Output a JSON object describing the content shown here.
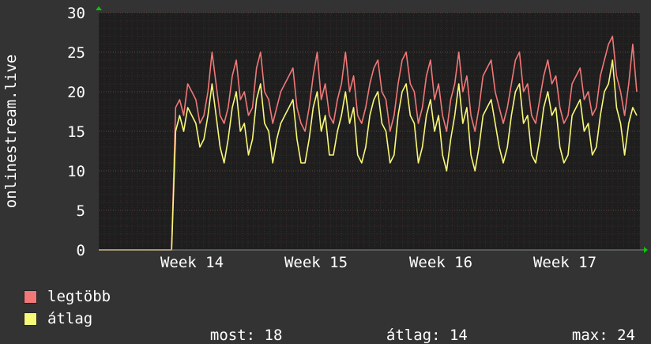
{
  "chart_data": {
    "type": "line",
    "ylabel": "onlinestream.live",
    "ylim": [
      0,
      30
    ],
    "yticks": [
      0,
      5,
      10,
      15,
      20,
      25,
      30
    ],
    "xticks": [
      "Week 14",
      "Week 15",
      "Week 16",
      "Week 17"
    ],
    "grid": true,
    "colors": {
      "background": "#333333",
      "plot": "#1e1e1e",
      "grid": "#5a3a3a",
      "text": "#ffffff",
      "arrow": "#00cc00"
    },
    "series": [
      {
        "name": "legtöbb",
        "color": "#f07878",
        "values": [
          0,
          0,
          0,
          0,
          0,
          0,
          0,
          0,
          0,
          0,
          0,
          0,
          0,
          0,
          0,
          0,
          0,
          0,
          0,
          18,
          19,
          17,
          21,
          20,
          19,
          16,
          17,
          20,
          25,
          21,
          17,
          16,
          18,
          22,
          24,
          19,
          20,
          17,
          18,
          23,
          25,
          20,
          19,
          16,
          18,
          20,
          21,
          22,
          23,
          18,
          16,
          15,
          18,
          22,
          25,
          19,
          21,
          17,
          16,
          19,
          21,
          25,
          20,
          22,
          17,
          16,
          18,
          21,
          23,
          24,
          20,
          19,
          15,
          17,
          21,
          24,
          25,
          21,
          20,
          16,
          18,
          22,
          24,
          19,
          21,
          17,
          15,
          19,
          21,
          25,
          20,
          22,
          17,
          15,
          18,
          22,
          23,
          24,
          20,
          18,
          16,
          18,
          21,
          24,
          25,
          20,
          21,
          17,
          16,
          19,
          22,
          24,
          21,
          22,
          18,
          16,
          17,
          21,
          22,
          23,
          19,
          20,
          17,
          18,
          22,
          24,
          26,
          27,
          22,
          20,
          17,
          21,
          26,
          20
        ]
      },
      {
        "name": "átlag",
        "color": "#f8f878",
        "values": [
          0,
          0,
          0,
          0,
          0,
          0,
          0,
          0,
          0,
          0,
          0,
          0,
          0,
          0,
          0,
          0,
          0,
          0,
          0,
          15,
          17,
          15,
          18,
          17,
          16,
          13,
          14,
          17,
          21,
          17,
          13,
          11,
          14,
          18,
          20,
          15,
          16,
          12,
          14,
          19,
          21,
          16,
          15,
          11,
          14,
          16,
          17,
          18,
          19,
          14,
          11,
          11,
          14,
          18,
          20,
          15,
          17,
          12,
          12,
          15,
          17,
          20,
          16,
          18,
          12,
          11,
          13,
          17,
          19,
          20,
          16,
          15,
          11,
          12,
          17,
          20,
          21,
          17,
          16,
          11,
          13,
          17,
          19,
          15,
          17,
          12,
          10,
          14,
          17,
          21,
          16,
          18,
          12,
          10,
          13,
          17,
          18,
          19,
          16,
          13,
          11,
          13,
          17,
          20,
          21,
          16,
          17,
          12,
          11,
          14,
          18,
          20,
          17,
          18,
          13,
          11,
          12,
          17,
          18,
          19,
          15,
          16,
          12,
          13,
          17,
          20,
          21,
          24,
          18,
          16,
          12,
          16,
          18,
          17
        ]
      }
    ]
  },
  "legend": [
    {
      "label": "legtöbb",
      "color": "#f07878"
    },
    {
      "label": "átlag",
      "color": "#f8f878"
    }
  ],
  "stats": {
    "most_label": "most:",
    "most_value": "18",
    "atlag_label": "átlag:",
    "atlag_value": "14",
    "max_label": "max:",
    "max_value": "24"
  }
}
